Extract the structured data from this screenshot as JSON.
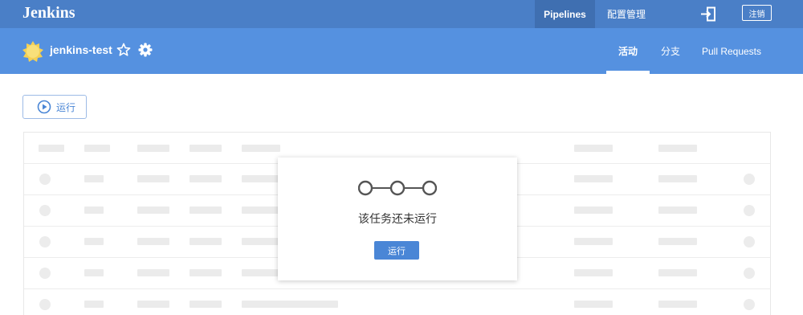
{
  "topbar": {
    "brand": "Jenkins",
    "nav_pipelines": "Pipelines",
    "nav_admin": "配置管理",
    "exit_icon": "exit-icon",
    "logout": "注销"
  },
  "project": {
    "name": "jenkins-test",
    "status_icon": "sun-icon",
    "favorite_icon": "star-icon",
    "settings_icon": "gear-icon"
  },
  "tabs": [
    {
      "label": "活动",
      "active": true
    },
    {
      "label": "分支",
      "active": false
    },
    {
      "label": "Pull Requests",
      "active": false
    }
  ],
  "run_button": {
    "label": "运行",
    "icon": "play-circle-icon"
  },
  "empty_state": {
    "title": "该任务还未运行",
    "button": "运行",
    "icon": "pipeline-nodes-icon"
  },
  "colors": {
    "topbar": "#4a7fc7",
    "subbar": "#5591e0",
    "accent": "#4a86d6"
  }
}
